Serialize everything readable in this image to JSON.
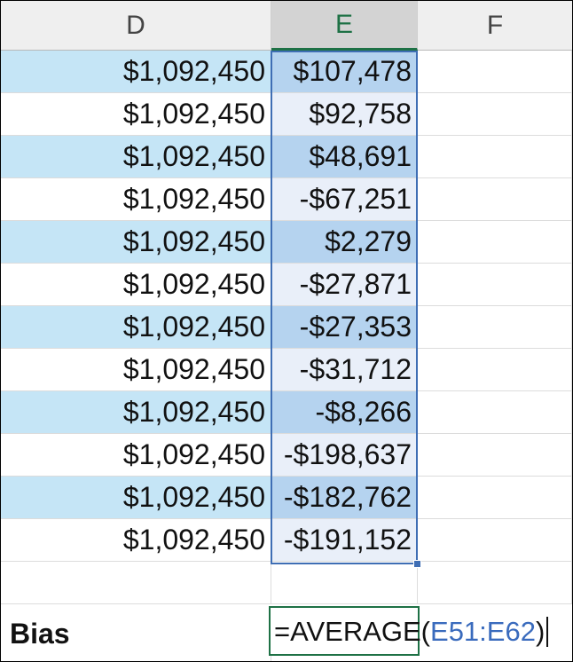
{
  "columns": [
    "D",
    "E",
    "F"
  ],
  "selected_column": "E",
  "rows": [
    {
      "d": "$1,092,450",
      "e": "$107,478"
    },
    {
      "d": "$1,092,450",
      "e": "$92,758"
    },
    {
      "d": "$1,092,450",
      "e": "$48,691"
    },
    {
      "d": "$1,092,450",
      "e": "-$67,251"
    },
    {
      "d": "$1,092,450",
      "e": "$2,279"
    },
    {
      "d": "$1,092,450",
      "e": "-$27,871"
    },
    {
      "d": "$1,092,450",
      "e": "-$27,353"
    },
    {
      "d": "$1,092,450",
      "e": "-$31,712"
    },
    {
      "d": "$1,092,450",
      "e": "-$8,266"
    },
    {
      "d": "$1,092,450",
      "e": "-$198,637"
    },
    {
      "d": "$1,092,450",
      "e": "-$182,762"
    },
    {
      "d": "$1,092,450",
      "e": "-$191,152"
    }
  ],
  "bias_label": "Bias",
  "formula": {
    "prefix": "=AVERAGE(",
    "range": "E51:E62",
    "suffix": ")"
  },
  "colors": {
    "band_light": "#c5e5f6",
    "band_selected": "#b5d3ef",
    "selection": "#3f6eb4",
    "active": "#1e7145"
  }
}
